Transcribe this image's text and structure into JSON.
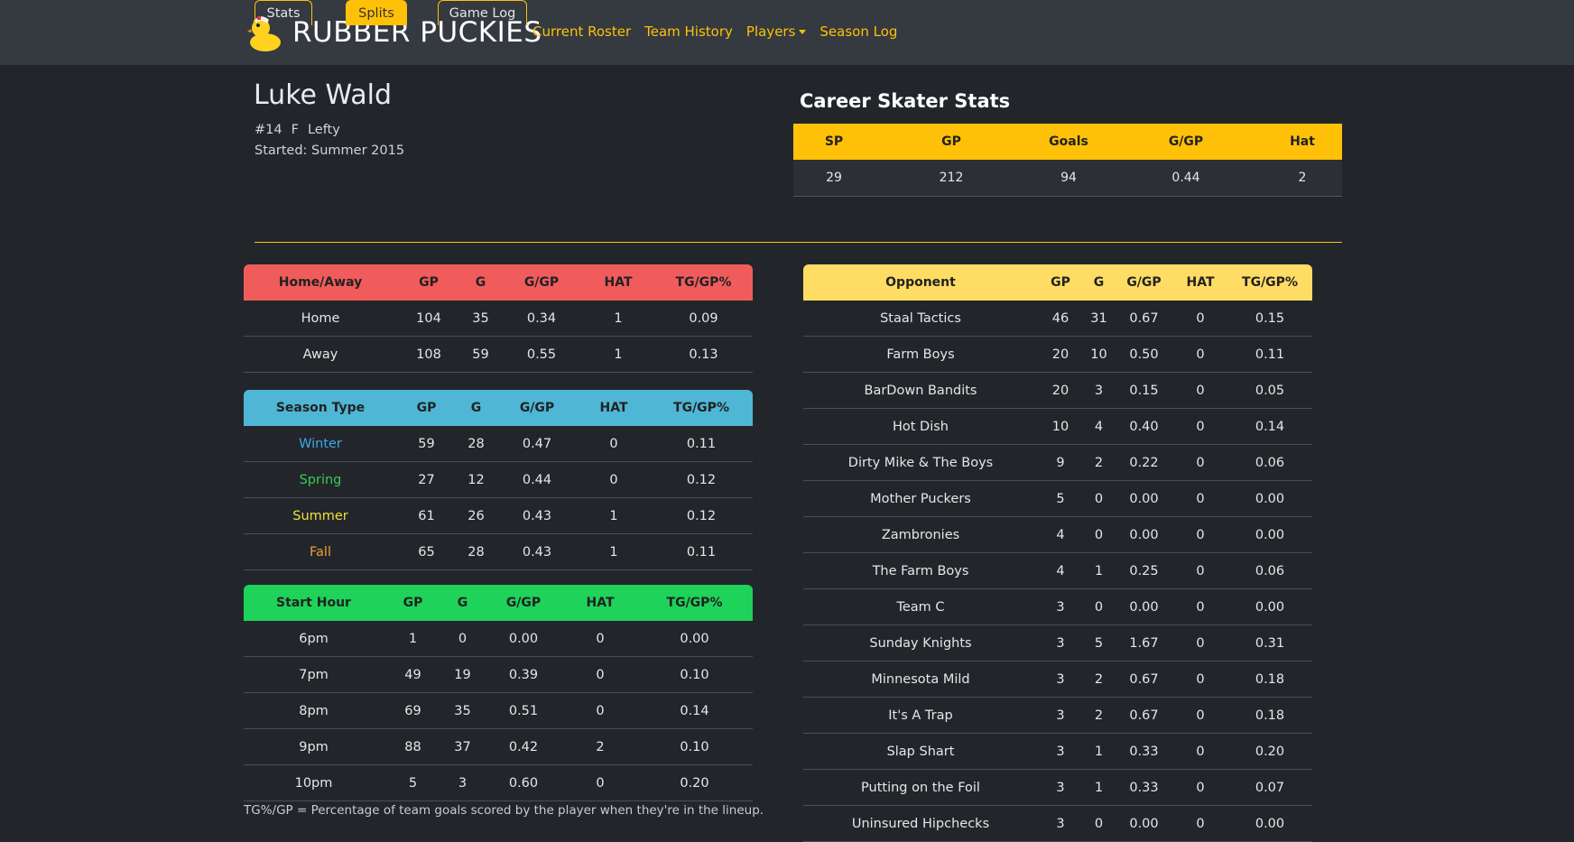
{
  "navbar": {
    "brand": "RUBBER PUCKIES",
    "links": [
      {
        "label": "Current Roster"
      },
      {
        "label": "Team History"
      },
      {
        "label": "Players"
      },
      {
        "label": "Season Log"
      }
    ],
    "accent": "#ffc107"
  },
  "player": {
    "name": "Luke Wald",
    "number": "#14",
    "position": "F",
    "hand": "Lefty",
    "started": "Started: Summer 2015"
  },
  "career": {
    "title": "Career Skater Stats",
    "headers": [
      "SP",
      "GP",
      "Goals",
      "G/GP",
      "Hat"
    ],
    "row": [
      "29",
      "212",
      "94",
      "0.44",
      "2"
    ]
  },
  "tabs": [
    {
      "label": "Stats",
      "active": false
    },
    {
      "label": "Splits",
      "active": true
    },
    {
      "label": "Game Log",
      "active": false
    }
  ],
  "home_away": {
    "color": "#f05c5c",
    "headers": [
      "Home/Away",
      "GP",
      "G",
      "G/GP",
      "HAT",
      "TG/GP%"
    ],
    "rows": [
      [
        "Home",
        "104",
        "35",
        "0.34",
        "1",
        "0.09"
      ],
      [
        "Away",
        "108",
        "59",
        "0.55",
        "1",
        "0.13"
      ]
    ]
  },
  "season_type": {
    "color": "#4fb6d6",
    "headers": [
      "Season Type",
      "GP",
      "G",
      "G/GP",
      "HAT",
      "TG/GP%"
    ],
    "rows": [
      [
        "Winter",
        "59",
        "28",
        "0.47",
        "0",
        "0.11"
      ],
      [
        "Spring",
        "27",
        "12",
        "0.44",
        "0",
        "0.12"
      ],
      [
        "Summer",
        "61",
        "26",
        "0.43",
        "1",
        "0.12"
      ],
      [
        "Fall",
        "65",
        "28",
        "0.43",
        "1",
        "0.11"
      ]
    ],
    "label_colors": [
      "#3ea8e8",
      "#3ec94e",
      "#f0e040",
      "#f0a030"
    ]
  },
  "start_hour": {
    "color": "#1ed25a",
    "headers": [
      "Start Hour",
      "GP",
      "G",
      "G/GP",
      "HAT",
      "TG/GP%"
    ],
    "rows": [
      [
        "6pm",
        "1",
        "0",
        "0.00",
        "0",
        "0.00"
      ],
      [
        "7pm",
        "49",
        "19",
        "0.39",
        "0",
        "0.10"
      ],
      [
        "8pm",
        "69",
        "35",
        "0.51",
        "0",
        "0.14"
      ],
      [
        "9pm",
        "88",
        "37",
        "0.42",
        "2",
        "0.10"
      ],
      [
        "10pm",
        "5",
        "3",
        "0.60",
        "0",
        "0.20"
      ]
    ]
  },
  "opponent": {
    "color": "#ffdc64",
    "headers": [
      "Opponent",
      "GP",
      "G",
      "G/GP",
      "HAT",
      "TG/GP%"
    ],
    "rows": [
      [
        "Staal Tactics",
        "46",
        "31",
        "0.67",
        "0",
        "0.15"
      ],
      [
        "Farm Boys",
        "20",
        "10",
        "0.50",
        "0",
        "0.11"
      ],
      [
        "BarDown Bandits",
        "20",
        "3",
        "0.15",
        "0",
        "0.05"
      ],
      [
        "Hot Dish",
        "10",
        "4",
        "0.40",
        "0",
        "0.14"
      ],
      [
        "Dirty Mike & The Boys",
        "9",
        "2",
        "0.22",
        "0",
        "0.06"
      ],
      [
        "Mother Puckers",
        "5",
        "0",
        "0.00",
        "0",
        "0.00"
      ],
      [
        "Zambronies",
        "4",
        "0",
        "0.00",
        "0",
        "0.00"
      ],
      [
        "The Farm Boys",
        "4",
        "1",
        "0.25",
        "0",
        "0.06"
      ],
      [
        "Team C",
        "3",
        "0",
        "0.00",
        "0",
        "0.00"
      ],
      [
        "Sunday Knights",
        "3",
        "5",
        "1.67",
        "0",
        "0.31"
      ],
      [
        "Minnesota Mild",
        "3",
        "2",
        "0.67",
        "0",
        "0.18"
      ],
      [
        "It's A Trap",
        "3",
        "2",
        "0.67",
        "0",
        "0.18"
      ],
      [
        "Slap Shart",
        "3",
        "1",
        "0.33",
        "0",
        "0.20"
      ],
      [
        "Putting on the Foil",
        "3",
        "1",
        "0.33",
        "0",
        "0.07"
      ],
      [
        "Uninsured Hipchecks",
        "3",
        "0",
        "0.00",
        "0",
        "0.00"
      ]
    ]
  },
  "footnote": "TG%/GP = Percentage of team goals scored by the player when they're in the lineup."
}
